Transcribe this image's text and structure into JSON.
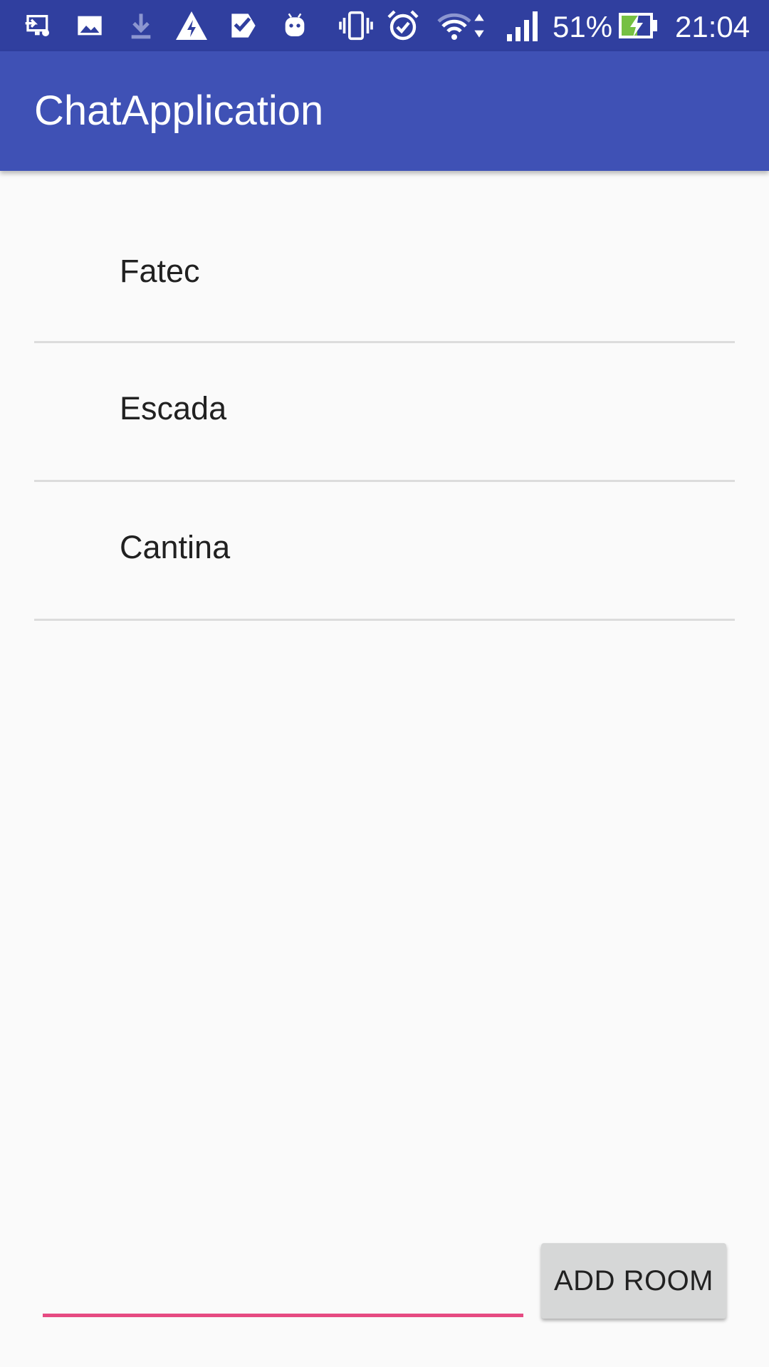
{
  "status_bar": {
    "icons": [
      "cast-screen-icon",
      "image-icon",
      "download-icon",
      "warning-icon",
      "check-app-icon",
      "android-icon",
      "vibrate-icon",
      "alarm-icon",
      "wifi-icon",
      "data-arrows-icon",
      "signal-icon",
      "battery-charging-icon"
    ],
    "battery_percent": "51%",
    "time": "21:04",
    "colors": {
      "background": "#303f9f",
      "battery_fill": "#76c043"
    }
  },
  "app_bar": {
    "title": "ChatApplication",
    "color": "#3f51b5"
  },
  "rooms": [
    {
      "label": "Fatec"
    },
    {
      "label": "Escada"
    },
    {
      "label": "Cantina"
    }
  ],
  "room_input": {
    "value": "",
    "placeholder": "",
    "underline_color": "#e64a82"
  },
  "add_button": {
    "label": "ADD ROOM"
  }
}
